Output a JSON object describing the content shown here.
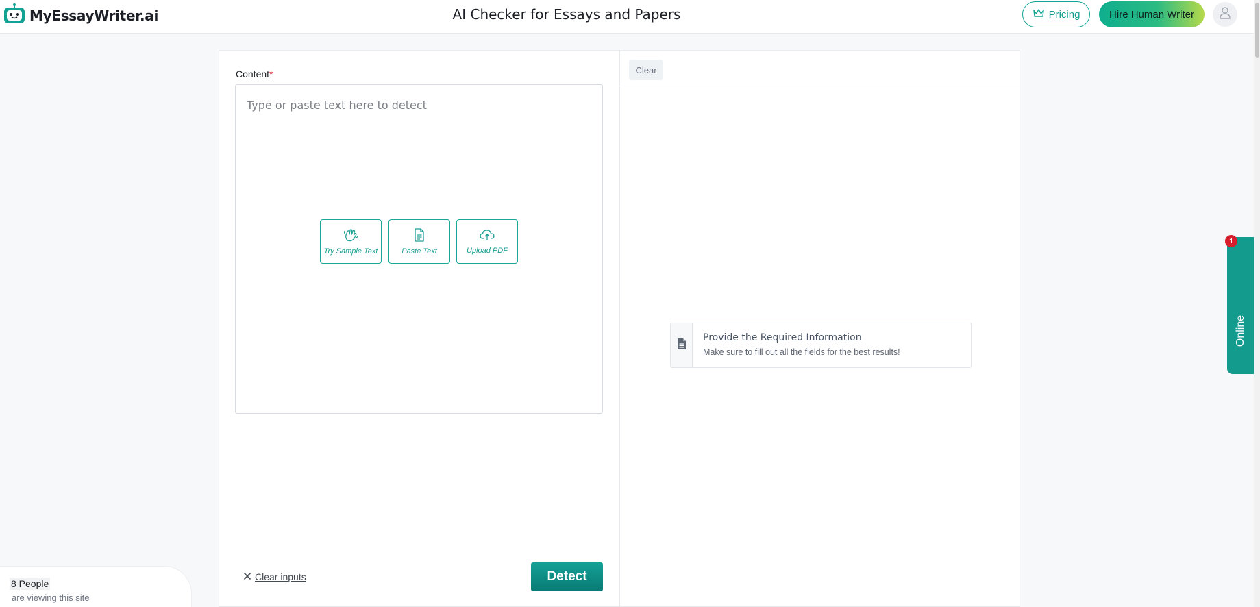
{
  "header": {
    "brand": "MyEssayWriter.ai",
    "page_title": "AI Checker for Essays and Papers",
    "pricing_label": "Pricing",
    "hire_label": "Hire Human Writer"
  },
  "editor": {
    "content_label": "Content",
    "required_mark": "*",
    "placeholder": "Type or paste text here to detect",
    "value": "",
    "actions": {
      "sample": "Try Sample Text",
      "paste": "Paste Text",
      "upload": "Upload PDF"
    },
    "clear_inputs": "Clear inputs",
    "detect": "Detect"
  },
  "results": {
    "clear": "Clear",
    "info_title": "Provide the Required Information",
    "info_subtitle": "Make sure to fill out all the fields for the best results!"
  },
  "viewers": {
    "count": "8 People",
    "text": "are viewing this site"
  },
  "chat": {
    "label": "Online",
    "badge": "1"
  },
  "colors": {
    "accent": "#13a394",
    "detect": "#0a857d",
    "badge": "#d81e2c",
    "required": "#e5484d"
  },
  "icons": [
    "robot-logo-icon",
    "crown-icon",
    "user-icon",
    "hand-wave-icon",
    "document-icon",
    "cloud-upload-icon",
    "close-icon",
    "file-text-icon"
  ]
}
